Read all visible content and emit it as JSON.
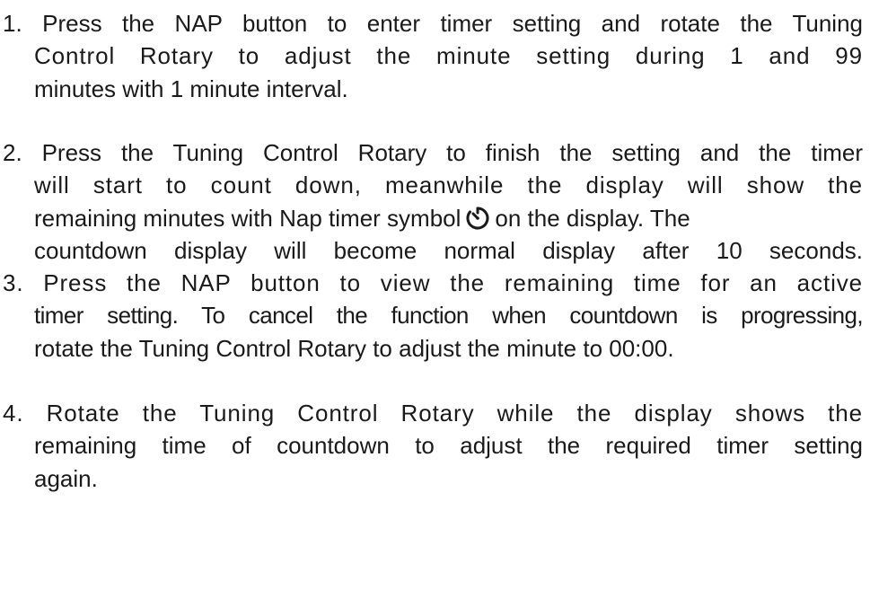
{
  "items": [
    {
      "lines": [
        "1. Press the NAP button to enter timer setting and rotate the Tuning",
        "Control Rotary to adjust the minute setting during 1 and 99",
        "minutes with 1 minute interval."
      ]
    },
    {
      "lines": [
        "2. Press the Tuning Control Rotary to finish the setting and the timer",
        "will start to count down, meanwhile the display will show the",
        "remaining minutes with Nap timer symbol",
        "on the display. The",
        "countdown display will become normal display after 10 seconds."
      ]
    },
    {
      "lines": [
        "3. Press the NAP button to view the remaining time for an active",
        "timer setting. To cancel the function when countdown is progressing,",
        "rotate the Tuning Control Rotary to adjust the minute to 00:00."
      ]
    },
    {
      "lines": [
        "4. Rotate the Tuning Control Rotary while the display shows the",
        "remaining time of countdown to adjust the required timer setting",
        "again."
      ]
    }
  ],
  "icons": {
    "nap_timer": "nap-timer-icon"
  }
}
